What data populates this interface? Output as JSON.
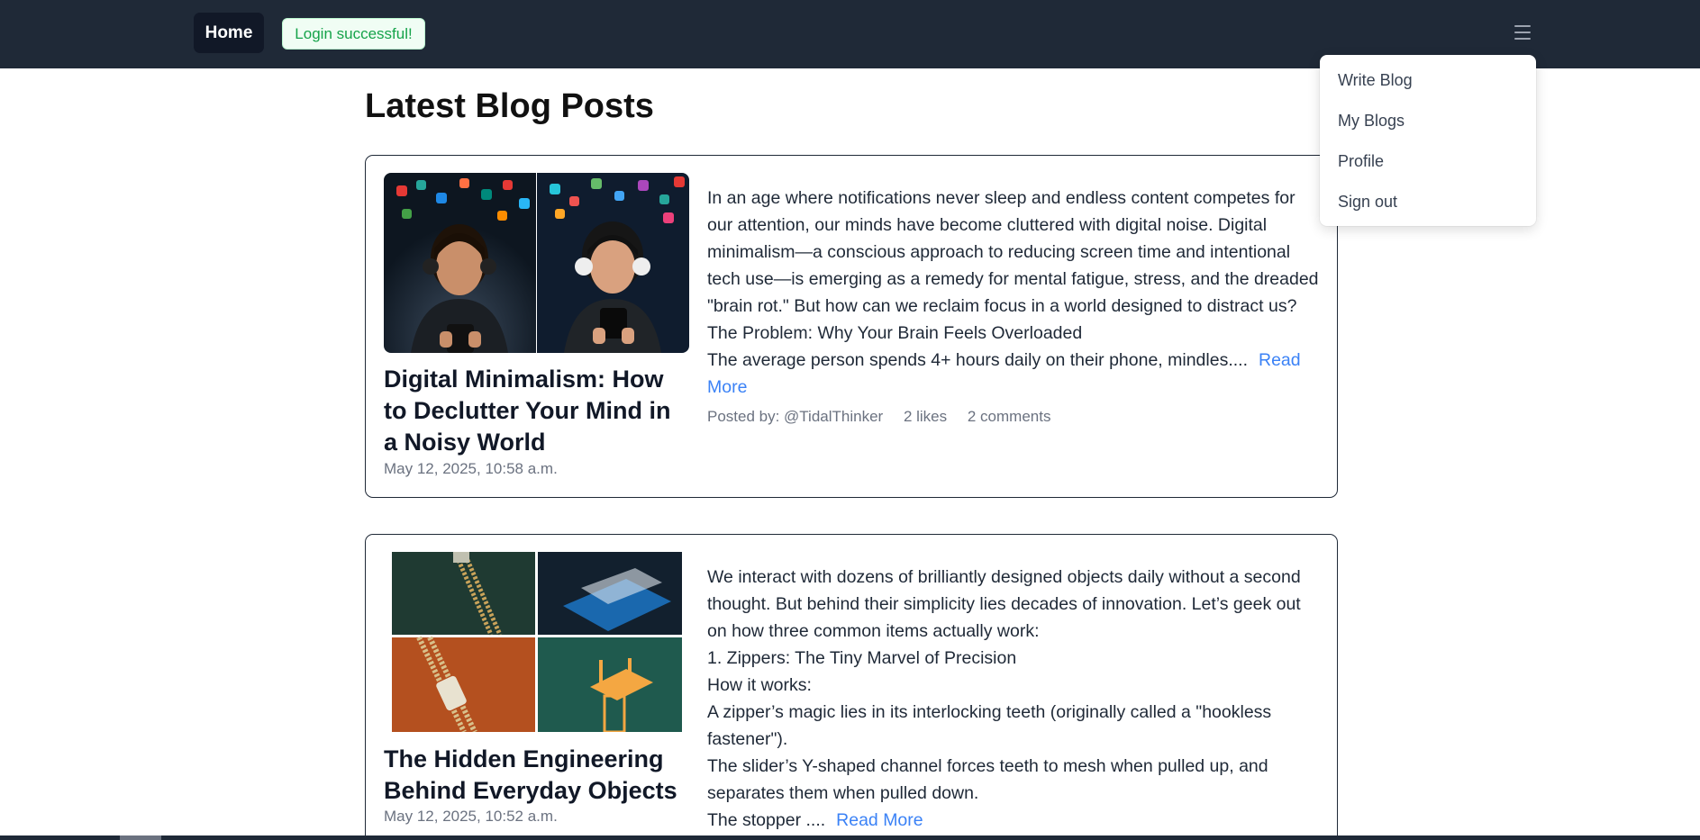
{
  "nav": {
    "home_label": "Home",
    "toast": "Login successful!",
    "menu_icon": "hamburger-icon"
  },
  "menu": {
    "items": [
      "Write Blog",
      "My Blogs",
      "Profile",
      "Sign out"
    ]
  },
  "page": {
    "title": "Latest Blog Posts"
  },
  "posts": [
    {
      "title": "Digital Minimalism: How to Declutter Your Mind in a Noisy World",
      "date": "May 12, 2025, 10:58 a.m.",
      "paragraphs": [
        "In an age where notifications never sleep and endless content competes for our attention, our minds have become cluttered with digital noise. Digital minimalism—a conscious approach to reducing screen time and intentional tech use—is emerging as a remedy for mental fatigue, stress, and the dreaded \"brain rot.\" But how can we reclaim focus in a world designed to distract us?",
        "The Problem: Why Your Brain Feels Overloaded",
        "The average person spends 4+ hours daily on their phone, mindles...."
      ],
      "read_more": "Read More",
      "author": "Posted by: @TidalThinker",
      "likes": "2 likes",
      "comments": "2 comments"
    },
    {
      "title": "The Hidden Engineering Behind Everyday Objects",
      "date": "May 12, 2025, 10:52 a.m.",
      "paragraphs": [
        "We interact with dozens of brilliantly designed objects daily without a second thought. But behind their simplicity lies decades of innovation. Let’s geek out on how three common items actually work:",
        "1. Zippers: The Tiny Marvel of Precision",
        "How it works:",
        "A zipper’s magic lies in its interlocking teeth (originally called a \"hookless fastener\").",
        "The slider’s Y-shaped channel forces teeth to mesh when pulled up, and separates them when pulled down.",
        "The stopper ...."
      ],
      "read_more": "Read More"
    }
  ],
  "colors": {
    "navbar": "#1f2937",
    "link": "#3b82f6",
    "toast_text": "#16a34a"
  }
}
